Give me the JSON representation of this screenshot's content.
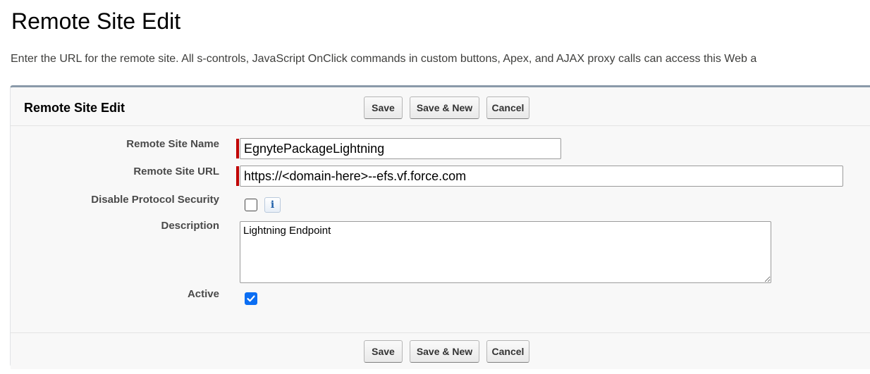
{
  "page": {
    "title": "Remote Site Edit",
    "description": "Enter the URL for the remote site. All s-controls, JavaScript OnClick commands in custom buttons, Apex, and AJAX proxy calls can access this Web a"
  },
  "panel": {
    "title": "Remote Site Edit",
    "buttons": {
      "save": "Save",
      "save_new": "Save & New",
      "cancel": "Cancel"
    }
  },
  "form": {
    "remote_site_name": {
      "label": "Remote Site Name",
      "value": "EgnytePackageLightning"
    },
    "remote_site_url": {
      "label": "Remote Site URL",
      "value": "https://<domain-here>--efs.vf.force.com"
    },
    "disable_protocol_security": {
      "label": "Disable Protocol Security",
      "checked": false,
      "info_icon": "info-icon"
    },
    "description": {
      "label": "Description",
      "value": "Lightning Endpoint"
    },
    "active": {
      "label": "Active",
      "checked": true
    }
  },
  "colors": {
    "required": "#c00000",
    "checkbox_checked": "#0b6ef3",
    "panel_border_top": "#8a9aa9"
  }
}
